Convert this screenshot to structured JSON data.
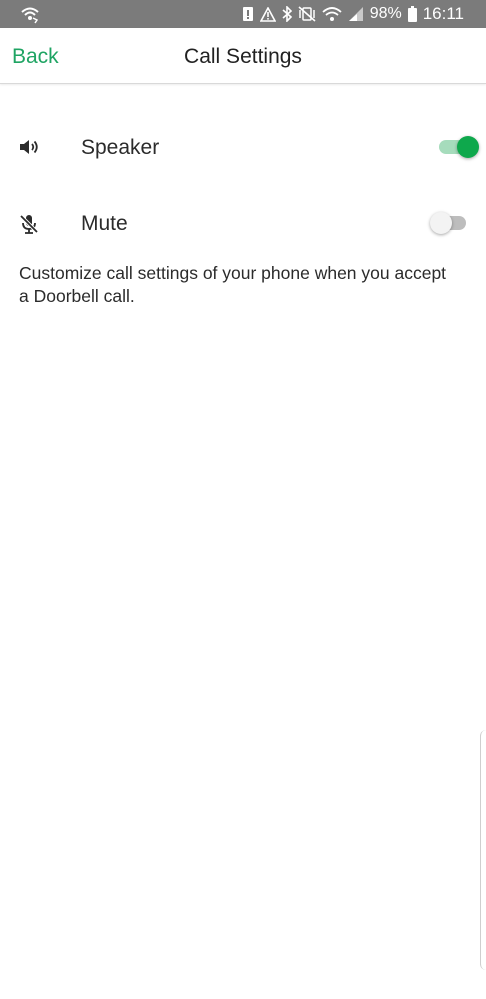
{
  "status_bar": {
    "battery": "98%",
    "time": "16:11",
    "icons": [
      "wifi-calling-icon",
      "sim-alert-icon",
      "warning-icon",
      "bluetooth-icon",
      "vibrate-mute-icon",
      "wifi-icon",
      "signal-icon",
      "battery-icon"
    ]
  },
  "header": {
    "back_label": "Back",
    "title": "Call Settings"
  },
  "settings": {
    "items": [
      {
        "label": "Speaker",
        "icon": "speaker-icon",
        "enabled": true
      },
      {
        "label": "Mute",
        "icon": "mic-mute-icon",
        "enabled": false
      }
    ],
    "description": "Customize call settings of your phone when you accept a Doorbell call."
  },
  "colors": {
    "accent": "#1fa463",
    "toggle_on": "#0ea84c",
    "status_bar": "#7b7b7b"
  }
}
